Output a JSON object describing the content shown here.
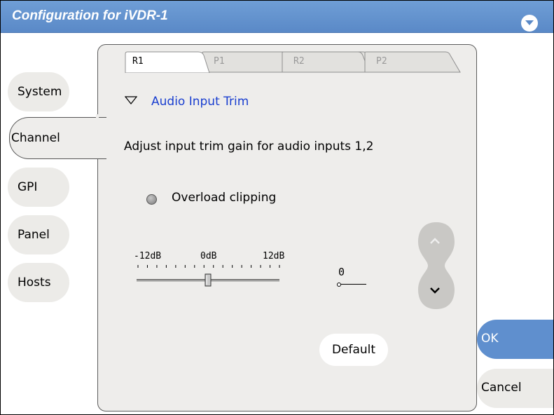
{
  "window": {
    "title": "Configuration for iVDR-1"
  },
  "sidebar": {
    "items": [
      {
        "label": "System"
      },
      {
        "label": "Channel"
      },
      {
        "label": "GPI"
      },
      {
        "label": "Panel"
      },
      {
        "label": "Hosts"
      }
    ],
    "active": "Channel"
  },
  "channel_tabs": {
    "items": [
      {
        "label": "R1"
      },
      {
        "label": "P1"
      },
      {
        "label": "R2"
      },
      {
        "label": "P2"
      }
    ],
    "active": "R1"
  },
  "section": {
    "title": "Audio Input Trim",
    "description": "Adjust input trim gain for audio inputs 1,2"
  },
  "overload": {
    "label": "Overload clipping",
    "state": "off"
  },
  "slider": {
    "min_label": "-12dB",
    "mid_label": "0dB",
    "max_label": "12dB",
    "min": -12,
    "max": 12,
    "value": 0
  },
  "value_display": "0",
  "buttons": {
    "default": "Default",
    "ok": "OK",
    "cancel": "Cancel"
  },
  "colors": {
    "titlebar": "#5f8fce",
    "section_title": "#1a3fd0",
    "ok_button": "#5f8fce"
  }
}
